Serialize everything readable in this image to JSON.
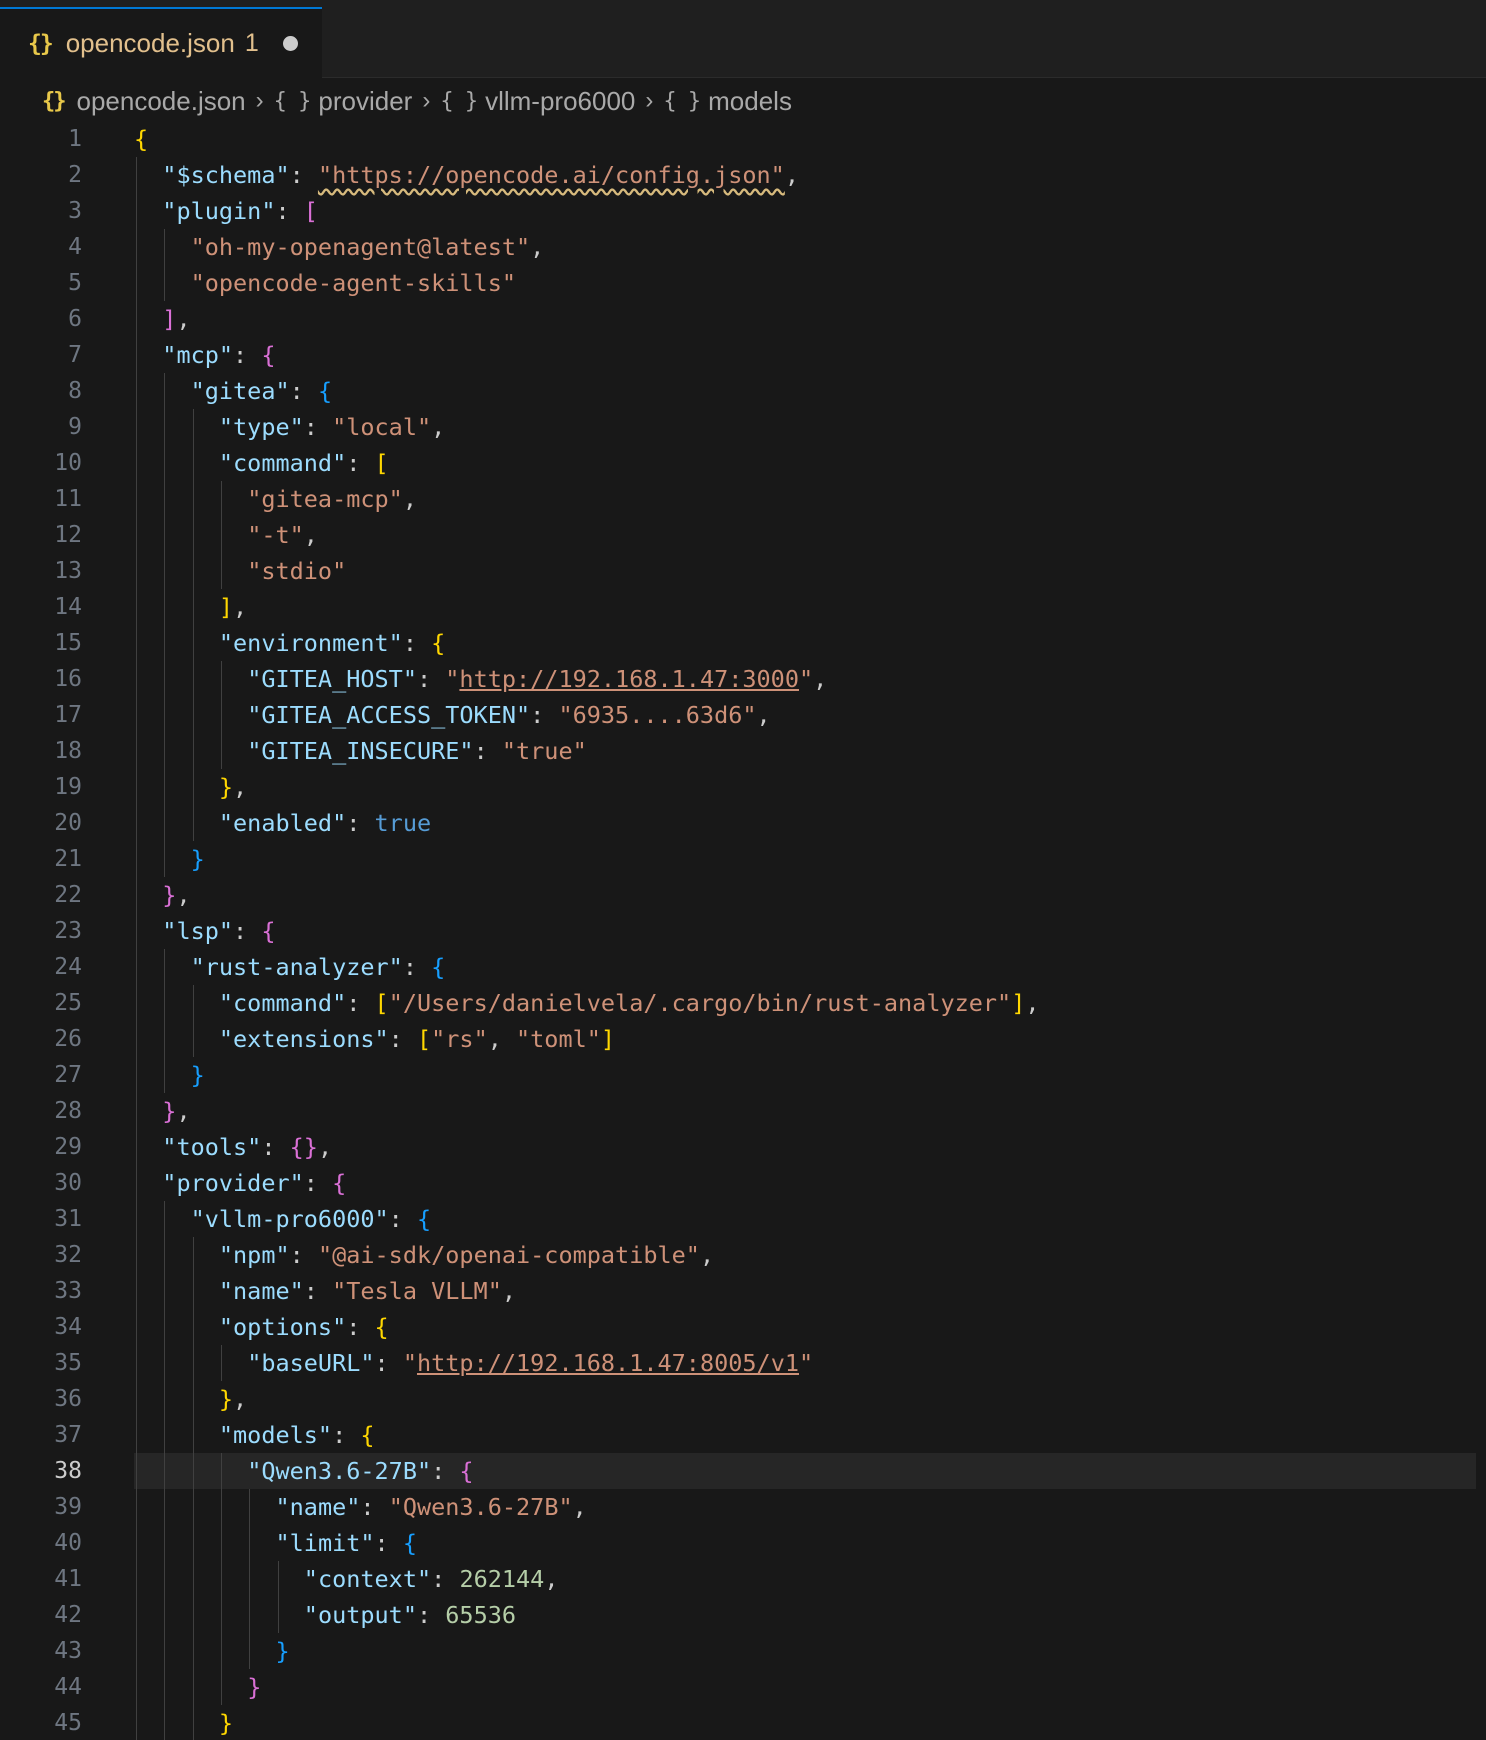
{
  "tab": {
    "icon": "{}",
    "title": "opencode.json",
    "problem_count": "1",
    "dirty_indicator": "unsaved-dot-icon"
  },
  "breadcrumb": [
    {
      "icon": "{}",
      "label": "opencode.json"
    },
    {
      "icon": "{ }",
      "label": "provider"
    },
    {
      "icon": "{ }",
      "label": "vllm-pro6000"
    },
    {
      "icon": "{ }",
      "label": "models"
    }
  ],
  "editor": {
    "current_line": 38,
    "lines": [
      {
        "n": "1",
        "d": 0,
        "t": [
          [
            "b1",
            "{"
          ]
        ]
      },
      {
        "n": "2",
        "d": 1,
        "t": [
          [
            "k",
            "\"$schema\""
          ],
          [
            "p",
            ": "
          ],
          [
            "s sq",
            "\"https://opencode.ai/config.json\""
          ],
          [
            "p",
            ","
          ]
        ]
      },
      {
        "n": "3",
        "d": 1,
        "t": [
          [
            "k",
            "\"plugin\""
          ],
          [
            "p",
            ": "
          ],
          [
            "b2",
            "["
          ]
        ]
      },
      {
        "n": "4",
        "d": 2,
        "t": [
          [
            "s",
            "\"oh-my-openagent@latest\""
          ],
          [
            "p",
            ","
          ]
        ]
      },
      {
        "n": "5",
        "d": 2,
        "t": [
          [
            "s",
            "\"opencode-agent-skills\""
          ]
        ]
      },
      {
        "n": "6",
        "d": 1,
        "t": [
          [
            "b2",
            "]"
          ],
          [
            "p",
            ","
          ]
        ]
      },
      {
        "n": "7",
        "d": 1,
        "t": [
          [
            "k",
            "\"mcp\""
          ],
          [
            "p",
            ": "
          ],
          [
            "b2",
            "{"
          ]
        ]
      },
      {
        "n": "8",
        "d": 2,
        "t": [
          [
            "k",
            "\"gitea\""
          ],
          [
            "p",
            ": "
          ],
          [
            "b3",
            "{"
          ]
        ]
      },
      {
        "n": "9",
        "d": 3,
        "t": [
          [
            "k",
            "\"type\""
          ],
          [
            "p",
            ": "
          ],
          [
            "s",
            "\"local\""
          ],
          [
            "p",
            ","
          ]
        ]
      },
      {
        "n": "10",
        "d": 3,
        "t": [
          [
            "k",
            "\"command\""
          ],
          [
            "p",
            ": "
          ],
          [
            "b1",
            "["
          ]
        ]
      },
      {
        "n": "11",
        "d": 4,
        "t": [
          [
            "s",
            "\"gitea-mcp\""
          ],
          [
            "p",
            ","
          ]
        ]
      },
      {
        "n": "12",
        "d": 4,
        "t": [
          [
            "s",
            "\"-t\""
          ],
          [
            "p",
            ","
          ]
        ]
      },
      {
        "n": "13",
        "d": 4,
        "t": [
          [
            "s",
            "\"stdio\""
          ]
        ]
      },
      {
        "n": "14",
        "d": 3,
        "t": [
          [
            "b1",
            "]"
          ],
          [
            "p",
            ","
          ]
        ]
      },
      {
        "n": "15",
        "d": 3,
        "t": [
          [
            "k",
            "\"environment\""
          ],
          [
            "p",
            ": "
          ],
          [
            "b1",
            "{"
          ]
        ]
      },
      {
        "n": "16",
        "d": 4,
        "t": [
          [
            "k",
            "\"GITEA_HOST\""
          ],
          [
            "p",
            ": "
          ],
          [
            "s",
            "\""
          ],
          [
            "s u",
            "http://192.168.1.47:3000"
          ],
          [
            "s",
            "\""
          ],
          [
            "p",
            ","
          ]
        ]
      },
      {
        "n": "17",
        "d": 4,
        "t": [
          [
            "k",
            "\"GITEA_ACCESS_TOKEN\""
          ],
          [
            "p",
            ": "
          ],
          [
            "s",
            "\"6935....63d6\""
          ],
          [
            "p",
            ","
          ]
        ]
      },
      {
        "n": "18",
        "d": 4,
        "t": [
          [
            "k",
            "\"GITEA_INSECURE\""
          ],
          [
            "p",
            ": "
          ],
          [
            "s",
            "\"true\""
          ]
        ]
      },
      {
        "n": "19",
        "d": 3,
        "t": [
          [
            "b1",
            "}"
          ],
          [
            "p",
            ","
          ]
        ]
      },
      {
        "n": "20",
        "d": 3,
        "t": [
          [
            "k",
            "\"enabled\""
          ],
          [
            "p",
            ": "
          ],
          [
            "kw",
            "true"
          ]
        ]
      },
      {
        "n": "21",
        "d": 2,
        "t": [
          [
            "b3",
            "}"
          ]
        ]
      },
      {
        "n": "22",
        "d": 1,
        "t": [
          [
            "b2",
            "}"
          ],
          [
            "p",
            ","
          ]
        ]
      },
      {
        "n": "23",
        "d": 1,
        "t": [
          [
            "k",
            "\"lsp\""
          ],
          [
            "p",
            ": "
          ],
          [
            "b2",
            "{"
          ]
        ]
      },
      {
        "n": "24",
        "d": 2,
        "t": [
          [
            "k",
            "\"rust-analyzer\""
          ],
          [
            "p",
            ": "
          ],
          [
            "b3",
            "{"
          ]
        ]
      },
      {
        "n": "25",
        "d": 3,
        "t": [
          [
            "k",
            "\"command\""
          ],
          [
            "p",
            ": "
          ],
          [
            "b1",
            "["
          ],
          [
            "s",
            "\"/Users/danielvela/.cargo/bin/rust-analyzer\""
          ],
          [
            "b1",
            "]"
          ],
          [
            "p",
            ","
          ]
        ]
      },
      {
        "n": "26",
        "d": 3,
        "t": [
          [
            "k",
            "\"extensions\""
          ],
          [
            "p",
            ": "
          ],
          [
            "b1",
            "["
          ],
          [
            "s",
            "\"rs\""
          ],
          [
            "p",
            ", "
          ],
          [
            "s",
            "\"toml\""
          ],
          [
            "b1",
            "]"
          ]
        ]
      },
      {
        "n": "27",
        "d": 2,
        "t": [
          [
            "b3",
            "}"
          ]
        ]
      },
      {
        "n": "28",
        "d": 1,
        "t": [
          [
            "b2",
            "}"
          ],
          [
            "p",
            ","
          ]
        ]
      },
      {
        "n": "29",
        "d": 1,
        "t": [
          [
            "k",
            "\"tools\""
          ],
          [
            "p",
            ": "
          ],
          [
            "b2",
            "{}"
          ],
          [
            "p",
            ","
          ]
        ]
      },
      {
        "n": "30",
        "d": 1,
        "t": [
          [
            "k",
            "\"provider\""
          ],
          [
            "p",
            ": "
          ],
          [
            "b2",
            "{"
          ]
        ]
      },
      {
        "n": "31",
        "d": 2,
        "t": [
          [
            "k",
            "\"vllm-pro6000\""
          ],
          [
            "p",
            ": "
          ],
          [
            "b3",
            "{"
          ]
        ]
      },
      {
        "n": "32",
        "d": 3,
        "t": [
          [
            "k",
            "\"npm\""
          ],
          [
            "p",
            ": "
          ],
          [
            "s",
            "\"@ai-sdk/openai-compatible\""
          ],
          [
            "p",
            ","
          ]
        ]
      },
      {
        "n": "33",
        "d": 3,
        "t": [
          [
            "k",
            "\"name\""
          ],
          [
            "p",
            ": "
          ],
          [
            "s",
            "\"Tesla VLLM\""
          ],
          [
            "p",
            ","
          ]
        ]
      },
      {
        "n": "34",
        "d": 3,
        "t": [
          [
            "k",
            "\"options\""
          ],
          [
            "p",
            ": "
          ],
          [
            "b1",
            "{"
          ]
        ]
      },
      {
        "n": "35",
        "d": 4,
        "t": [
          [
            "k",
            "\"baseURL\""
          ],
          [
            "p",
            ": "
          ],
          [
            "s",
            "\""
          ],
          [
            "s u",
            "http://192.168.1.47:8005/v1"
          ],
          [
            "s",
            "\""
          ]
        ]
      },
      {
        "n": "36",
        "d": 3,
        "t": [
          [
            "b1",
            "}"
          ],
          [
            "p",
            ","
          ]
        ]
      },
      {
        "n": "37",
        "d": 3,
        "t": [
          [
            "k",
            "\"models\""
          ],
          [
            "p",
            ": "
          ],
          [
            "b1",
            "{"
          ]
        ]
      },
      {
        "n": "38",
        "d": 4,
        "t": [
          [
            "k",
            "\"Qwen3.6-27B\""
          ],
          [
            "p",
            ": "
          ],
          [
            "b2",
            "{"
          ]
        ]
      },
      {
        "n": "39",
        "d": 5,
        "t": [
          [
            "k",
            "\"name\""
          ],
          [
            "p",
            ": "
          ],
          [
            "s",
            "\"Qwen3.6-27B\""
          ],
          [
            "p",
            ","
          ]
        ]
      },
      {
        "n": "40",
        "d": 5,
        "t": [
          [
            "k",
            "\"limit\""
          ],
          [
            "p",
            ": "
          ],
          [
            "b3",
            "{"
          ]
        ]
      },
      {
        "n": "41",
        "d": 6,
        "t": [
          [
            "k",
            "\"context\""
          ],
          [
            "p",
            ": "
          ],
          [
            "n",
            "262144"
          ],
          [
            "p",
            ","
          ]
        ]
      },
      {
        "n": "42",
        "d": 6,
        "t": [
          [
            "k",
            "\"output\""
          ],
          [
            "p",
            ": "
          ],
          [
            "n",
            "65536"
          ]
        ]
      },
      {
        "n": "43",
        "d": 5,
        "t": [
          [
            "b3",
            "}"
          ]
        ]
      },
      {
        "n": "44",
        "d": 4,
        "t": [
          [
            "b2",
            "}"
          ]
        ]
      },
      {
        "n": "45",
        "d": 3,
        "t": [
          [
            "b1",
            "}"
          ]
        ]
      }
    ]
  }
}
